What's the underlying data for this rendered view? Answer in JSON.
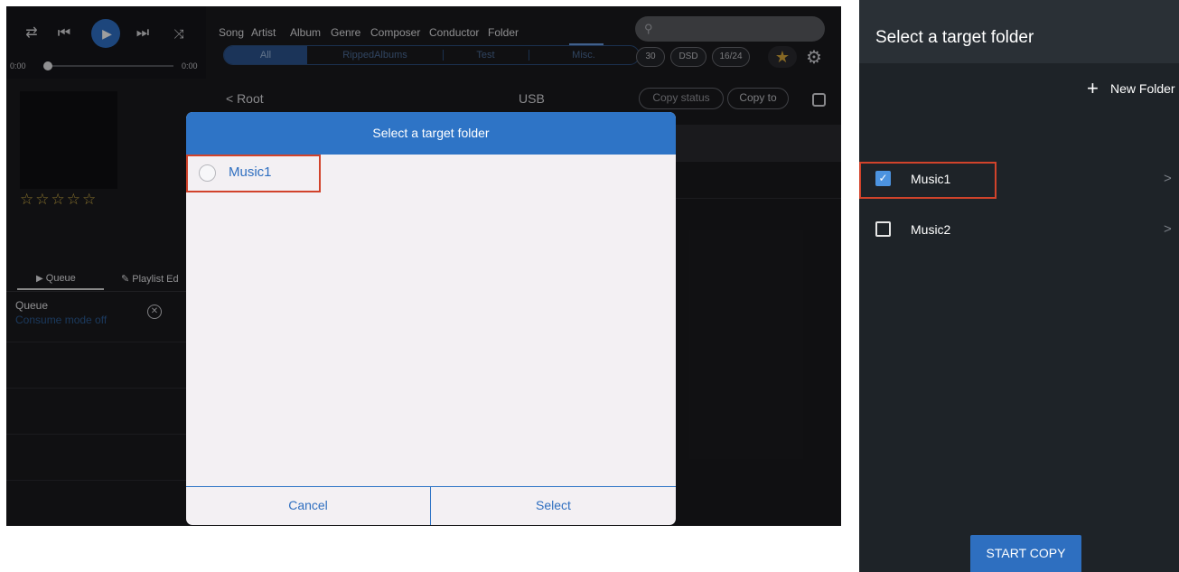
{
  "left_screen": {
    "player": {
      "time_elapsed": "0:00",
      "time_total": "0:00",
      "progress": 0,
      "icons": [
        "repeat-icon",
        "previous-icon",
        "play-icon",
        "next-icon",
        "shuffle-icon"
      ]
    },
    "side_panel": {
      "rating": "☆☆☆☆☆",
      "tabs": [
        {
          "label": "Queue",
          "icon": "play-triangle-icon",
          "active": true
        },
        {
          "label": "Playlist Ed",
          "icon": "pencil-icon"
        }
      ],
      "queue_title": "Queue",
      "queue_subtitle": "Consume mode off"
    },
    "nav_tabs": [
      "Song",
      "Artist",
      "Album",
      "Genre",
      "Composer",
      "Conductor",
      "Folder"
    ],
    "active_nav_tab": "Folder",
    "segments": [
      "All",
      "RippedAlbums",
      "Test",
      "Misc."
    ],
    "active_segment": "All",
    "search_icon": "search-icon",
    "chips": [
      "30",
      "DSD",
      "16/24"
    ],
    "root_link": "< Root",
    "location_title": "USB",
    "copy_status_label": "Copy status",
    "copy_to_label": "Copy to",
    "dialog": {
      "title": "Select a target folder",
      "items": [
        "Music1"
      ],
      "cancel_label": "Cancel",
      "select_label": "Select"
    }
  },
  "right_screen": {
    "title": "Select a target folder",
    "new_folder_label": "New Folder",
    "folders": [
      {
        "name": "Music1",
        "checked": true
      },
      {
        "name": "Music2",
        "checked": false
      }
    ],
    "chevron": ">",
    "start_copy_label": "START COPY"
  },
  "colors": {
    "accent_blue": "#2e74c6",
    "highlight_red": "#d1432b",
    "star_gold": "#d9a93b"
  }
}
